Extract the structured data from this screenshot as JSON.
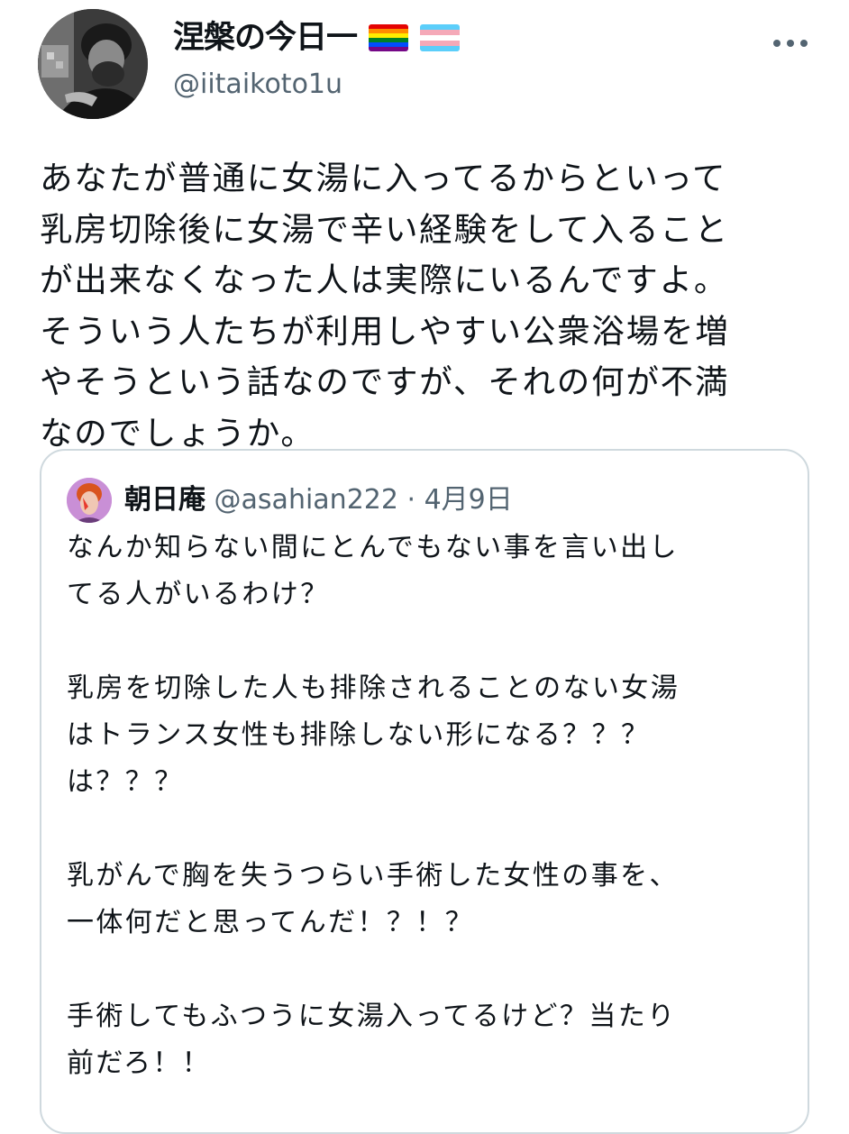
{
  "tweet": {
    "author": {
      "display_name": "涅槃の今日一",
      "handle": "@iitaikoto1u",
      "flags": [
        "rainbow-flag-icon",
        "transgender-flag-icon"
      ]
    },
    "text": "あなたが普通に女湯に入ってるからといって\n乳房切除後に女湯で辛い経験をして入ること\nが出来なくなった人は実際にいるんですよ。\nそういう人たちが利用しやすい公衆浴場を増\nやそうという話なのですが、それの何が不満\nなのでしょうか。"
  },
  "quoted_tweet": {
    "author": {
      "display_name": "朝日庵",
      "handle": "@asahian222"
    },
    "separator": "·",
    "date": "4月9日",
    "text": "なんか知らない間にとんでもない事を言い出し\nてる人がいるわけ？\n\n乳房を切除した人も排除されることのない女湯\nはトランス女性も排除しない形になる？？？\nは？？？\n\n乳がんで胸を失うつらい手術した女性の事を、\n一体何だと思ってんだ！？！？\n\n手術してもふつうに女湯入ってるけど？当たり\n前だろ！！"
  },
  "colors": {
    "text_primary": "#0f1419",
    "text_secondary": "#536471",
    "border": "#cfd9de",
    "background": "#ffffff"
  }
}
